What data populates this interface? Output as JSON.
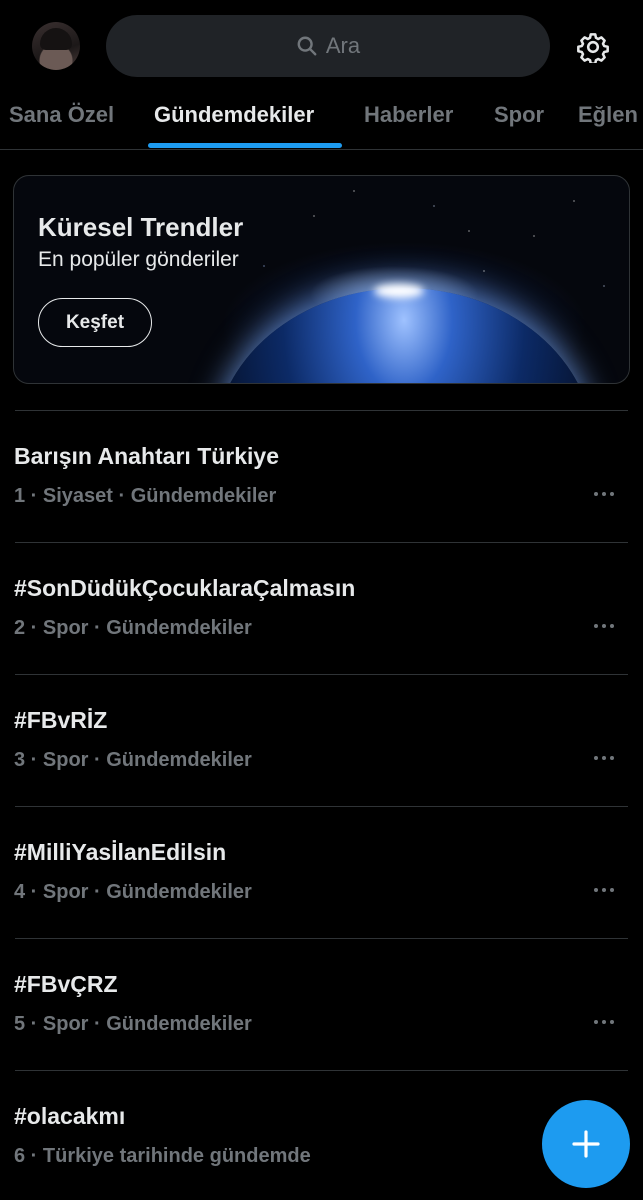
{
  "header": {
    "search_placeholder": "Ara",
    "avatar_icon": "user-avatar",
    "settings_icon": "gear-icon"
  },
  "tabs": [
    {
      "label": "Sana Özel",
      "active": false
    },
    {
      "label": "Gündemdekiler",
      "active": true
    },
    {
      "label": "Haberler",
      "active": false
    },
    {
      "label": "Spor",
      "active": false
    },
    {
      "label": "Eğlen",
      "active": false
    }
  ],
  "banner": {
    "title": "Küresel Trendler",
    "subtitle": "En popüler gönderiler",
    "button_label": "Keşfet"
  },
  "trends": [
    {
      "name": "Barışın Anahtarı Türkiye",
      "meta": "1 · Siyaset · Gündemdekiler"
    },
    {
      "name": "#SonDüdükÇocuklaraÇalmasın",
      "meta": "2 · Spor · Gündemdekiler"
    },
    {
      "name": "#FBvRİZ",
      "meta": "3 · Spor · Gündemdekiler"
    },
    {
      "name": "#MilliYasİlanEdilsin",
      "meta": "4 · Spor · Gündemdekiler"
    },
    {
      "name": "#FBvÇRZ",
      "meta": "5 · Spor · Gündemdekiler"
    },
    {
      "name": "#olacakmı",
      "meta": "6 · Türkiye tarihinde gündemde"
    }
  ],
  "colors": {
    "accent": "#1d9bf0",
    "background": "#000000",
    "text_primary": "#e7e9ea",
    "text_secondary": "#71767b",
    "divider": "#2f3336"
  }
}
